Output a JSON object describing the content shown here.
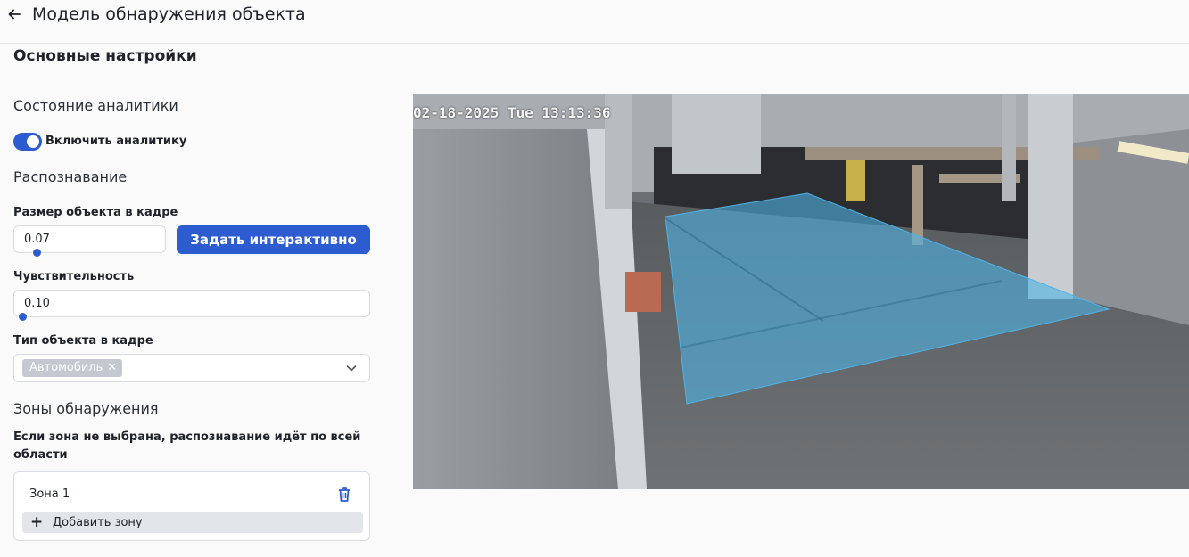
{
  "header": {
    "back_icon": "arrow-left-icon",
    "title": "Модель обнаружения объекта"
  },
  "settings": {
    "section_title": "Основные настройки",
    "analytics": {
      "title": "Состояние аналитики",
      "toggle_label": "Включить аналитику",
      "enabled": true
    },
    "recognition": {
      "title": "Распознавание",
      "object_size": {
        "label": "Размер объекта в кадре",
        "value": "0.07",
        "slider_fraction": 0.07
      },
      "set_interactive_label": "Задать интерактивно",
      "sensitivity": {
        "label": "Чувствительность",
        "value": "0.10",
        "slider_fraction": 0.0
      },
      "object_type": {
        "label": "Тип объекта в кадре",
        "selected": "Автомобиль"
      }
    },
    "zones": {
      "title": "Зоны обнаружения",
      "hint": "Если зона не выбрана, распознавание идёт по всей области",
      "items": [
        {
          "name": "Зона 1"
        }
      ],
      "add_label": "Добавить зону"
    }
  },
  "camera": {
    "timestamp": "02-18-2025 Tue 13:13:36",
    "zone_color": "#4fb3e6"
  },
  "colors": {
    "accent": "#2c5ccf"
  }
}
